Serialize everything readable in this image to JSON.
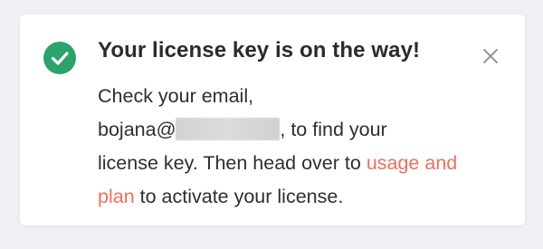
{
  "toast": {
    "title": "Your license key is on the way!",
    "message": {
      "line1": "Check your email,",
      "email_prefix": "bojana@",
      "after_email": ", to find your",
      "line3_text": "license key. Then head over to ",
      "link_label": "usage and plan",
      "after_link": " to activate your license."
    },
    "icons": {
      "status": "check-circle-icon",
      "close": "close-icon"
    },
    "colors": {
      "success": "#2ba36c",
      "link": "#ef6f5c"
    }
  }
}
